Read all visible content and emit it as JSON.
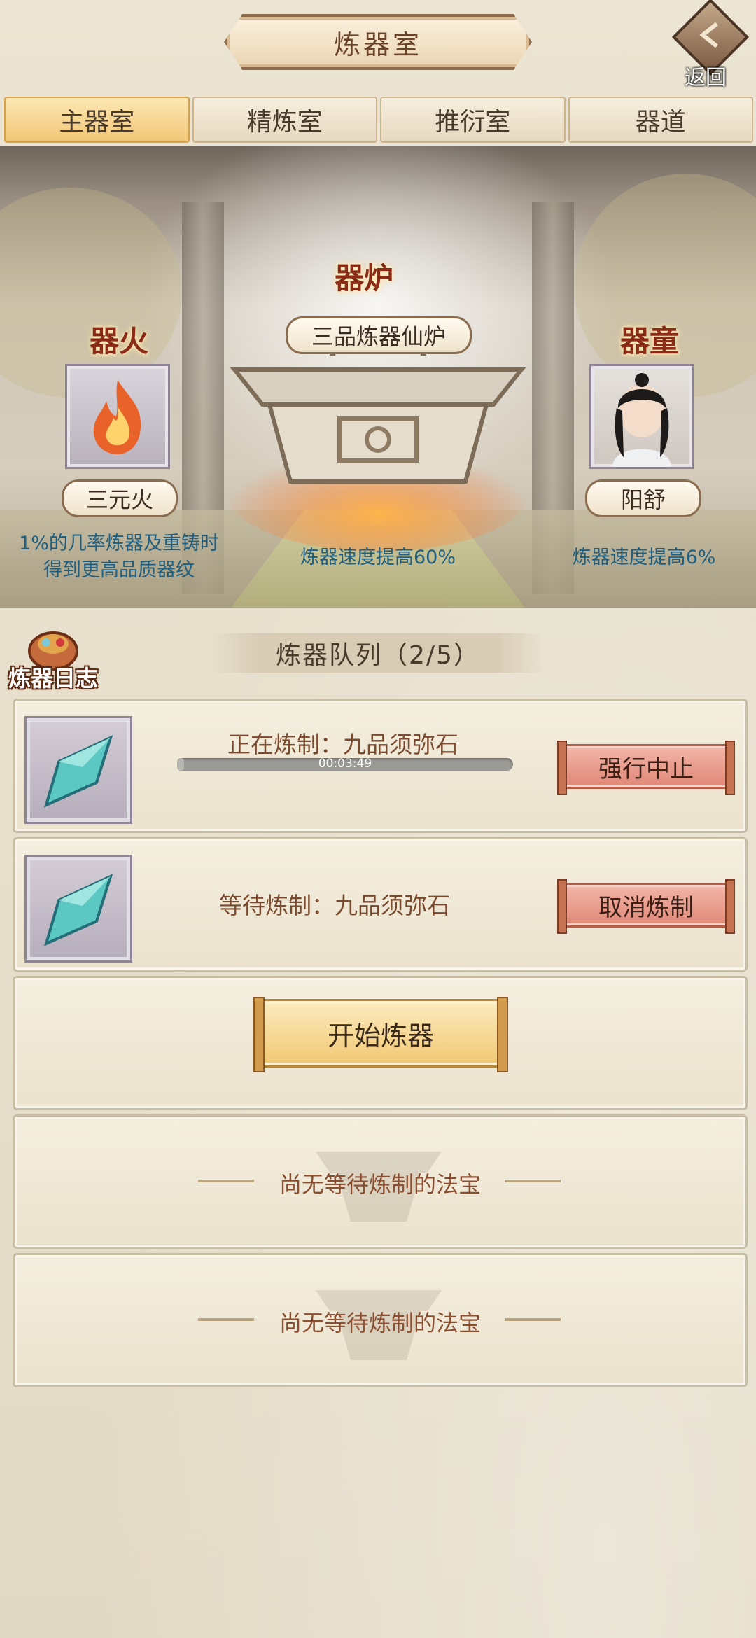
{
  "header": {
    "title": "炼器室",
    "back_label": "返回"
  },
  "tabs": [
    {
      "label": "主器室",
      "active": true
    },
    {
      "label": "精炼室",
      "active": false
    },
    {
      "label": "推衍室",
      "active": false
    },
    {
      "label": "器道",
      "active": false
    }
  ],
  "scene": {
    "fire": {
      "section_label": "器火",
      "name": "三元火",
      "desc_line1": "1%的几率炼器及重铸时",
      "desc_line2": "得到更高品质器纹"
    },
    "furnace": {
      "section_label": "器炉",
      "name": "三品炼器仙炉",
      "desc": "炼器速度提高60%"
    },
    "apprentice": {
      "section_label": "器童",
      "name": "阳舒",
      "desc": "炼器速度提高6%"
    }
  },
  "log": {
    "label": "炼器日志"
  },
  "queue": {
    "title": "炼器队列（2/5）",
    "active": {
      "label": "正在炼制：九品须弥石",
      "time": "00:03:49",
      "progress_fraction": 0.02,
      "button": "强行中止"
    },
    "waiting": {
      "label": "等待炼制：九品须弥石",
      "button": "取消炼制"
    },
    "start_button": "开始炼器",
    "empty_slots": [
      "尚无等待炼制的法宝",
      "尚无等待炼制的法宝"
    ]
  },
  "colors": {
    "accent_red": "#8a2b16",
    "desc_blue": "#1f5f82",
    "progress_track": "#9b9a95"
  },
  "icons": [
    "back-icon",
    "flame-icon",
    "cauldron-icon",
    "apprentice-avatar",
    "crystal-icon",
    "log-icon"
  ]
}
